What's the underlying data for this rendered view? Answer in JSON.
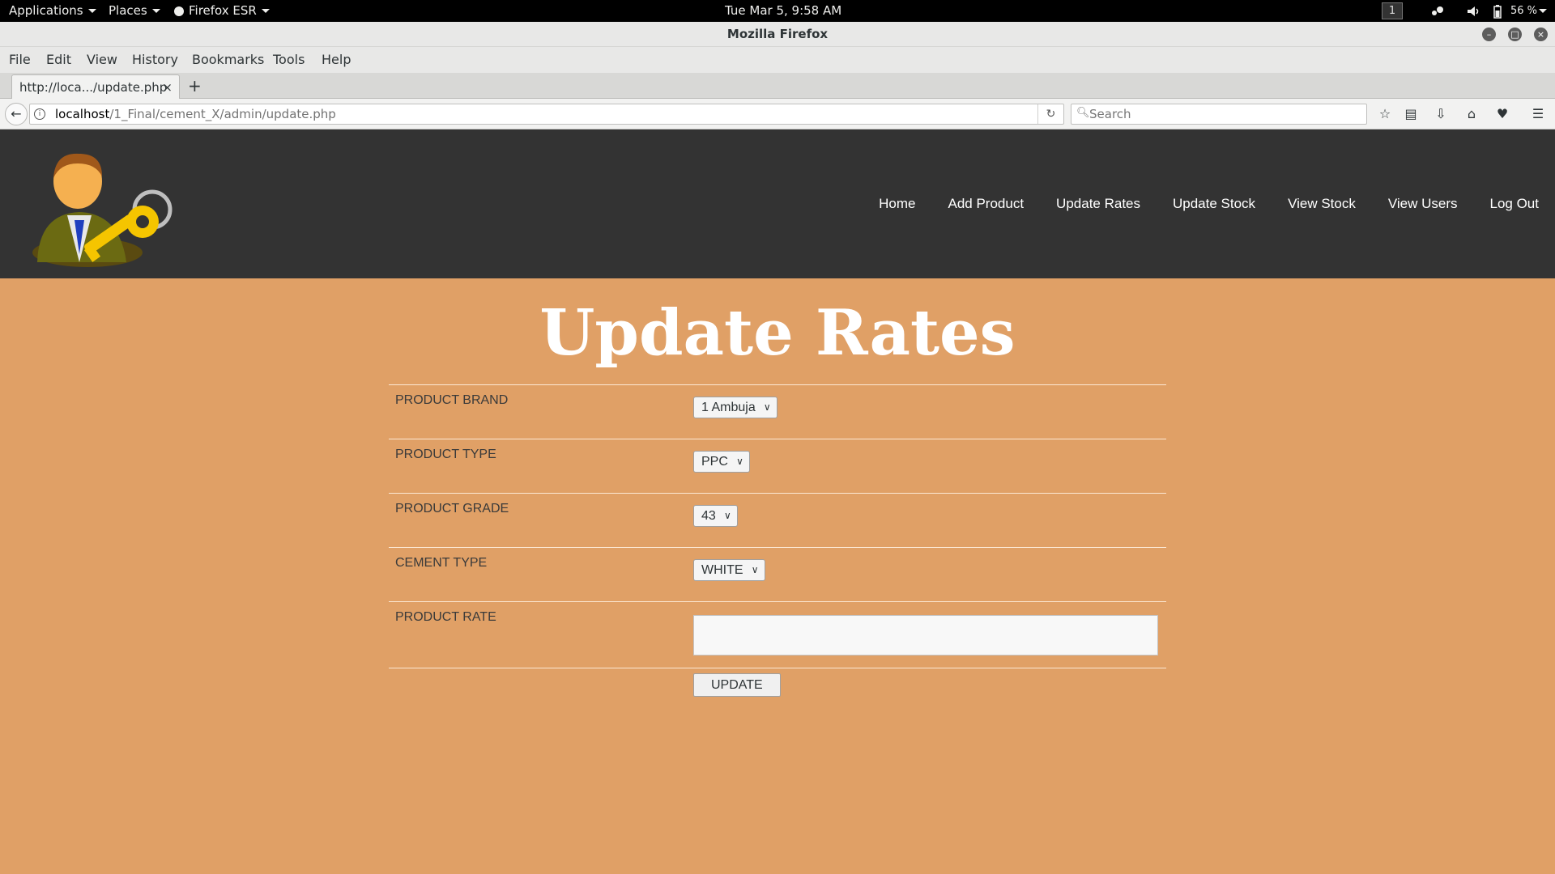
{
  "system_bar": {
    "applications": "Applications",
    "places": "Places",
    "firefox": "Firefox ESR",
    "datetime": "Tue Mar  5,  9:58 AM",
    "workspace": "1",
    "battery": "56 %"
  },
  "window": {
    "title": "Mozilla Firefox"
  },
  "menu": {
    "file": "File",
    "edit": "Edit",
    "view": "View",
    "history": "History",
    "bookmarks": "Bookmarks",
    "tools": "Tools",
    "help": "Help"
  },
  "tab": {
    "label": "http://loca.../update.php",
    "close": "×",
    "new": "+"
  },
  "address": {
    "host": "localhost",
    "path": "/1_Final/cement_X/admin/update.php",
    "search_placeholder": "Search"
  },
  "site": {
    "nav": [
      "Home",
      "Add Product",
      "Update Rates",
      "Update Stock",
      "View Stock",
      "View Users",
      "Log Out"
    ],
    "title": "Update Rates"
  },
  "form": {
    "brand_label": "PRODUCT BRAND",
    "brand_value": "1 Ambuja",
    "type_label": "PRODUCT TYPE",
    "type_value": "PPC",
    "grade_label": "PRODUCT GRADE",
    "grade_value": "43",
    "cement_label": "CEMENT TYPE",
    "cement_value": "WHITE",
    "rate_label": "PRODUCT RATE",
    "rate_value": "",
    "submit": "UPDATE"
  },
  "colors": {
    "header_bg": "#333333",
    "page_bg": "#e0a066",
    "title": "#ffffff"
  },
  "icons": [
    "back-arrow-icon",
    "info-icon",
    "reload-icon",
    "search-icon",
    "star-icon",
    "reading-list-icon",
    "download-icon",
    "home-icon",
    "pocket-icon",
    "hamburger-menu-icon"
  ]
}
